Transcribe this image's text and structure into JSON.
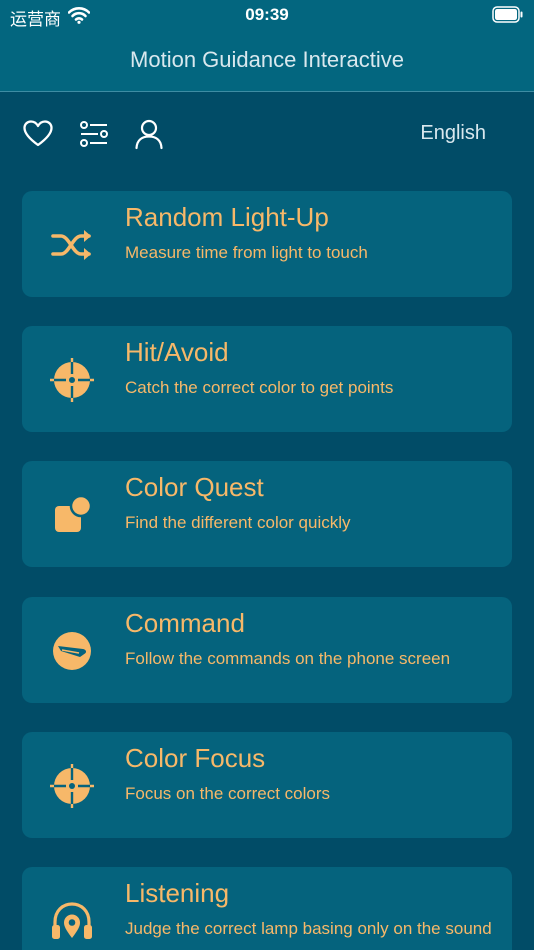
{
  "status_bar": {
    "carrier": "运营商",
    "time": "09:39"
  },
  "header": {
    "title": "Motion Guidance Interactive"
  },
  "toolbar": {
    "icons": [
      "heart-icon",
      "settings-list-icon",
      "user-icon"
    ],
    "language": "English"
  },
  "colors": {
    "background": "#014C67",
    "header": "#03667F",
    "card": "#05637D",
    "accent": "#F7B869"
  },
  "games": [
    {
      "title": "Random Light-Up",
      "description": "Measure time from light to touch",
      "icon": "shuffle-icon"
    },
    {
      "title": "Hit/Avoid",
      "description": "Catch the correct color to get points",
      "icon": "crosshair-icon"
    },
    {
      "title": "Color Quest",
      "description": "Find the different color quickly",
      "icon": "shapes-icon"
    },
    {
      "title": "Command",
      "description": "Follow the commands on the phone screen",
      "icon": "phone-command-icon"
    },
    {
      "title": "Color Focus",
      "description": "Focus on the correct colors",
      "icon": "crosshair-icon"
    },
    {
      "title": "Listening",
      "description": "Judge the correct lamp basing only on the sound",
      "icon": "headphones-location-icon"
    }
  ]
}
